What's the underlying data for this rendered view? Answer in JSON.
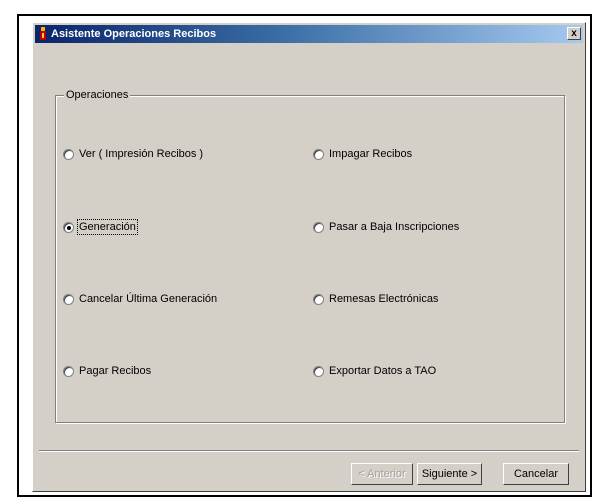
{
  "window": {
    "title": "Asistente Operaciones Recibos",
    "close_glyph": "x",
    "icon": "app-icon"
  },
  "group": {
    "label": "Operaciones"
  },
  "options": [
    {
      "id": "ver",
      "label": "Ver ( Impresión Recibos )",
      "checked": false
    },
    {
      "id": "impagar",
      "label": "Impagar Recibos",
      "checked": false
    },
    {
      "id": "generacion",
      "label": "Generación",
      "checked": true
    },
    {
      "id": "pasar-baja",
      "label": "Pasar a Baja Inscripciones",
      "checked": false
    },
    {
      "id": "cancelar-ultima",
      "label": "Cancelar Última Generación",
      "checked": false
    },
    {
      "id": "remesas",
      "label": "Remesas Electrónicas",
      "checked": false
    },
    {
      "id": "pagar",
      "label": "Pagar Recibos",
      "checked": false
    },
    {
      "id": "exportar",
      "label": "Exportar Datos a TAO",
      "checked": false
    }
  ],
  "buttons": {
    "back": "< Anterior",
    "next": "Siguiente >",
    "cancel": "Cancelar"
  },
  "colors": {
    "titlebar_start": "#0a246a",
    "titlebar_end": "#a6caf0",
    "face": "#d4d0c8"
  }
}
